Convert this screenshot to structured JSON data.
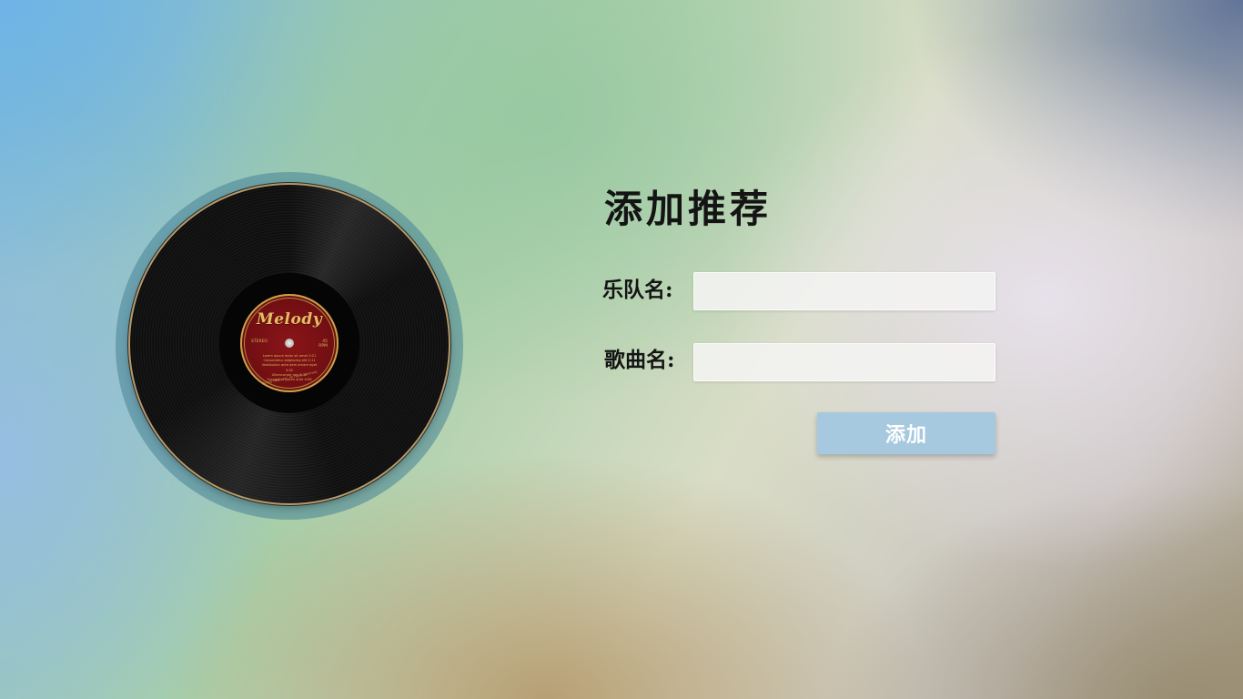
{
  "form": {
    "title": "添加推荐",
    "band_label": "乐队名:",
    "band_value": "",
    "song_label": "歌曲名:",
    "song_value": "",
    "submit_label": "添加"
  },
  "record": {
    "brand": "Melody",
    "label_left": "STEREO",
    "label_right_top": "45",
    "label_right_bottom": "RPM",
    "track_lines": [
      "Lorem ipsum dolor sit amet 3:21",
      "Consectetur adipiscing elit 2:11",
      "Vestibulum ante aem ornare eget 3:02",
      "Ullamcorper nec 2:30",
      "Suscipit in ipsum ante 4:06"
    ],
    "copyright": "Melody Music Inc. All rights reserved"
  },
  "colors": {
    "button_bg": "#a6c9e0",
    "label_red": "#8a1518",
    "label_gold": "#d8b45c"
  },
  "icons": [
    "vinyl-record-icon"
  ]
}
